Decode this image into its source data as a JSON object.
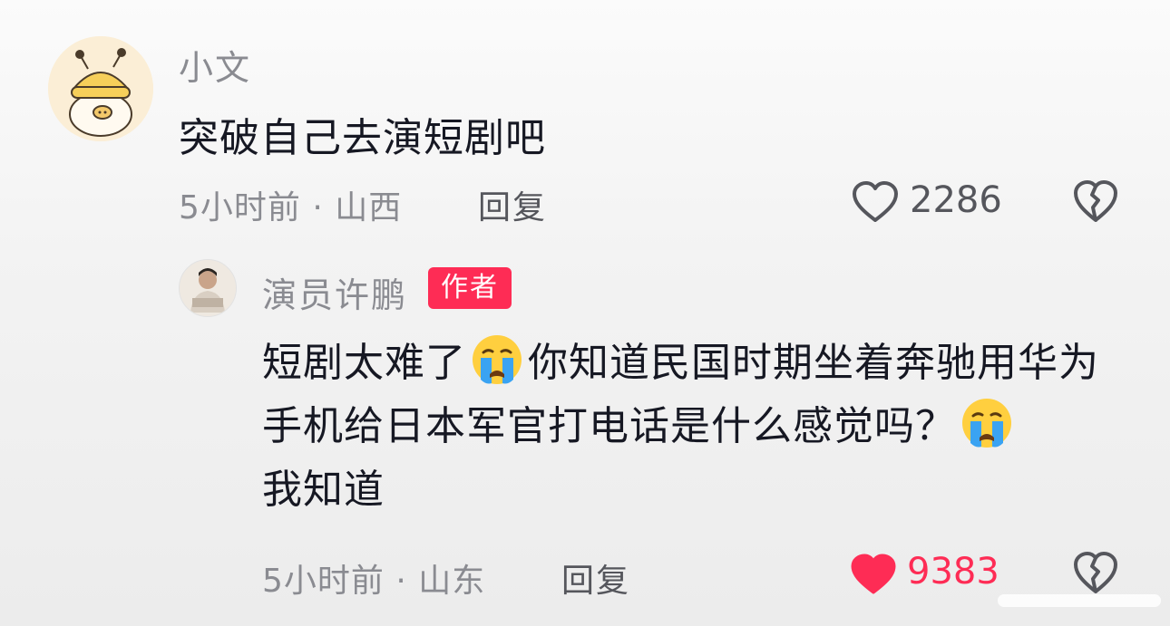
{
  "comment": {
    "username": "小文",
    "text": "突破自己去演短剧吧",
    "meta": "5小时前 · 山西",
    "reply_label": "回复",
    "likes": "2286",
    "avatar_icon": "cartoon-bee-hat-avatar"
  },
  "reply": {
    "username": "演员许鹏",
    "badge": "作者",
    "text_part1": "短剧太难了",
    "text_part2": "你知道民国时期坐着奔驰用华为手机给日本军官打电话是什么感觉吗？",
    "text_part3": "我知道",
    "emoji_icon": "crying-face-emoji",
    "meta": "5小时前 · 山东",
    "reply_label": "回复",
    "likes": "9383",
    "liked": true,
    "avatar_icon": "actor-photo-avatar"
  },
  "colors": {
    "accent": "#fe2c55",
    "muted_text": "#8a8b91",
    "primary_text": "#161823"
  }
}
